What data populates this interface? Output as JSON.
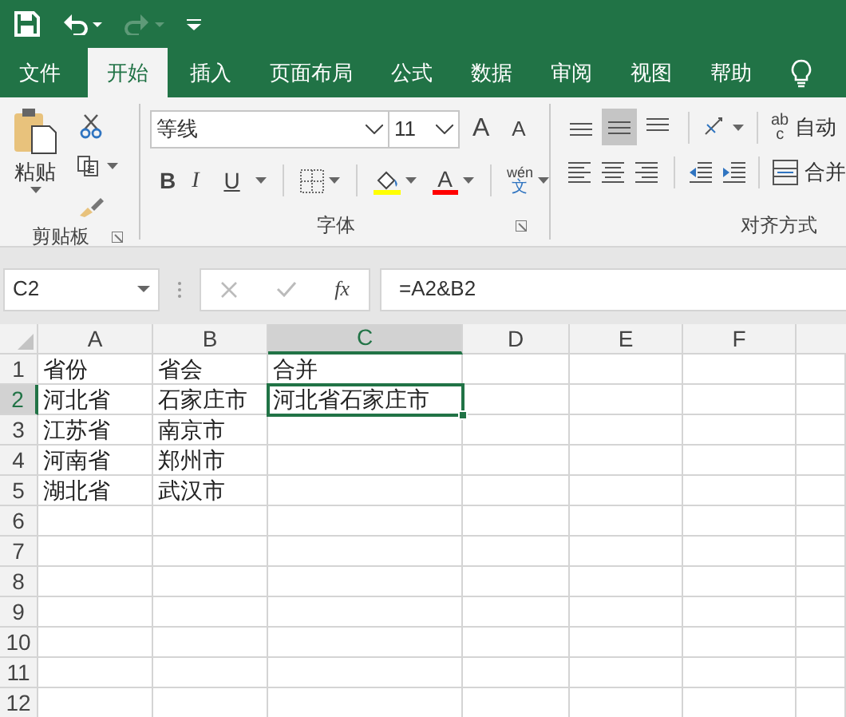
{
  "quick_access": [
    {
      "kind": "save",
      "disabled": false
    },
    {
      "kind": "undo",
      "disabled": false
    },
    {
      "kind": "redo",
      "disabled": true
    },
    {
      "kind": "customize",
      "disabled": false
    }
  ],
  "tabs": [
    {
      "label": "文件",
      "selected": false
    },
    {
      "label": "开始",
      "selected": true
    },
    {
      "label": "插入",
      "selected": false
    },
    {
      "label": "页面布局",
      "selected": false
    },
    {
      "label": "公式",
      "selected": false
    },
    {
      "label": "数据",
      "selected": false
    },
    {
      "label": "审阅",
      "selected": false
    },
    {
      "label": "视图",
      "selected": false
    },
    {
      "label": "帮助",
      "selected": false
    }
  ],
  "ribbon": {
    "clipboard": {
      "label": "剪贴板",
      "paste": "粘贴"
    },
    "font": {
      "label": "字体",
      "font_name": "等线",
      "font_size": "11",
      "grow": "A",
      "shrink": "A",
      "styles": [
        {
          "kind": "bold",
          "label": "B"
        },
        {
          "kind": "italic",
          "label": "I"
        },
        {
          "kind": "underline",
          "label": "U"
        }
      ],
      "font_color": {
        "label": "A"
      },
      "phonetic": {
        "top": "wén",
        "bottom": "文"
      }
    },
    "alignment": {
      "label": "对齐方式",
      "vertical": [
        {
          "kind": "top",
          "selected": false
        },
        {
          "kind": "middle",
          "selected": true
        },
        {
          "kind": "bottom",
          "selected": false
        }
      ],
      "horizontal": [
        {
          "kind": "left",
          "selected": false
        },
        {
          "kind": "center",
          "selected": false
        },
        {
          "kind": "right",
          "selected": false
        }
      ],
      "wrap_text": {
        "icon_lines": [
          "ab",
          "c"
        ],
        "label": "自动"
      },
      "merge": {
        "label": "合并"
      }
    }
  },
  "formula_bar": {
    "name_box": "C2",
    "function_button": "fx",
    "formula": "=A2&B2"
  },
  "columns": [
    {
      "label": "A",
      "selected": false
    },
    {
      "label": "B",
      "selected": false
    },
    {
      "label": "C",
      "selected": true
    },
    {
      "label": "D",
      "selected": false
    },
    {
      "label": "E",
      "selected": false
    },
    {
      "label": "F",
      "selected": false
    }
  ],
  "rows": [
    {
      "number": "1",
      "selected": false,
      "cells": [
        {
          "text": "省份",
          "active": false
        },
        {
          "text": "省会",
          "active": false
        },
        {
          "text": "合并",
          "active": false
        }
      ]
    },
    {
      "number": "2",
      "selected": true,
      "cells": [
        {
          "text": "河北省",
          "active": false
        },
        {
          "text": "石家庄市",
          "active": false
        },
        {
          "text": "河北省石家庄市",
          "active": true
        }
      ]
    },
    {
      "number": "3",
      "selected": false,
      "cells": [
        {
          "text": "江苏省",
          "active": false
        },
        {
          "text": "南京市",
          "active": false
        }
      ]
    },
    {
      "number": "4",
      "selected": false,
      "cells": [
        {
          "text": "河南省",
          "active": false
        },
        {
          "text": "郑州市",
          "active": false
        }
      ]
    },
    {
      "number": "5",
      "selected": false,
      "cells": [
        {
          "text": "湖北省",
          "active": false
        },
        {
          "text": "武汉市",
          "active": false
        }
      ]
    },
    {
      "number": "6",
      "selected": false,
      "cells": []
    },
    {
      "number": "7",
      "selected": false,
      "cells": []
    },
    {
      "number": "8",
      "selected": false,
      "cells": []
    },
    {
      "number": "9",
      "selected": false,
      "cells": []
    },
    {
      "number": "10",
      "selected": false,
      "cells": []
    },
    {
      "number": "11",
      "selected": false,
      "cells": []
    },
    {
      "number": "12",
      "selected": false,
      "cells": []
    }
  ]
}
